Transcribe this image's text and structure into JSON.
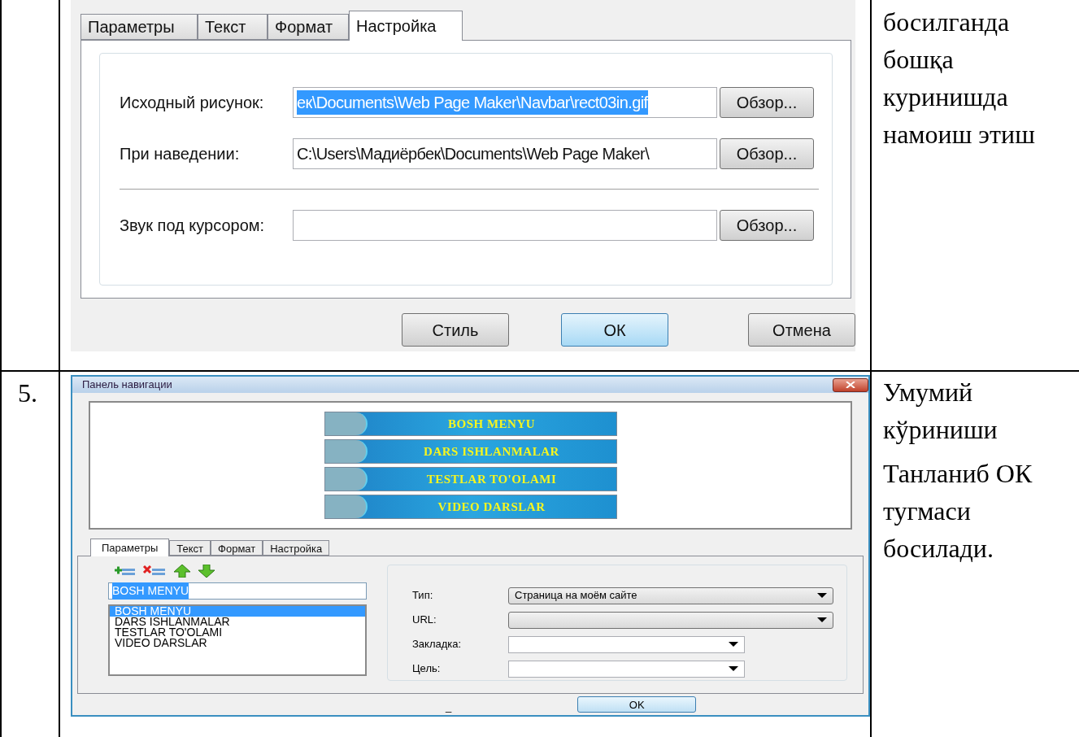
{
  "row_1": {
    "dialog": {
      "tabs": [
        {
          "label": "Параметры",
          "selected": false
        },
        {
          "label": "Текст",
          "selected": false
        },
        {
          "label": "Формат",
          "selected": false
        },
        {
          "label": "Настройка",
          "selected": true
        }
      ],
      "fields": [
        {
          "label": "Исходный рисунок:",
          "value": "ек\\Documents\\Web Page Maker\\Navbar\\rect03in.gif",
          "selected": true,
          "button": "Обзор..."
        },
        {
          "label": "При наведении:",
          "value": "C:\\Users\\Мадиёрбек\\Documents\\Web Page Maker\\",
          "selected": false,
          "button": "Обзор..."
        },
        {
          "label": "Звук под курсором:",
          "button": "Обзор..."
        }
      ],
      "buttons": [
        {
          "label": "Стиль",
          "default": false
        },
        {
          "label": "ОК",
          "default": true
        },
        {
          "label": "Отмена",
          "default": false
        }
      ]
    },
    "note": [
      "босилганда бошқа куринишда намоиш этиш"
    ]
  },
  "row_2": {
    "number": "5.",
    "window": {
      "title": "Панель навигации",
      "preview_buttons": [
        "BOSH MENYU",
        "DARS ISHLANMALAR",
        "TESTLAR TO'OLAMI",
        "VIDEO DARSLAR"
      ],
      "tabs": [
        {
          "label": "Параметры",
          "selected": true
        },
        {
          "label": "Текст",
          "selected": false
        },
        {
          "label": "Формат",
          "selected": false
        },
        {
          "label": "Настройка",
          "selected": false
        }
      ],
      "name_field": {
        "value": "BOSH MENYU",
        "selected": true
      },
      "list": [
        {
          "label": "BOSH MENYU",
          "selected": true
        },
        {
          "label": "DARS ISHLANMALAR",
          "selected": false
        },
        {
          "label": "TESTLAR TO'OLAMI",
          "selected": false
        },
        {
          "label": "VIDEO DARSLAR",
          "selected": false
        }
      ],
      "form": [
        {
          "label": "Тип:",
          "kind": "select",
          "value": "Страница на моём сайте"
        },
        {
          "label": "URL:",
          "kind": "select"
        },
        {
          "label": "Закладка:",
          "kind": "combo"
        },
        {
          "label": "Цель:",
          "kind": "combo"
        }
      ],
      "footer_mark": "_",
      "ok_button": "OK"
    },
    "note": [
      "Умумий кўриниши",
      "Танланиб ОК тугмаси босилади."
    ]
  }
}
